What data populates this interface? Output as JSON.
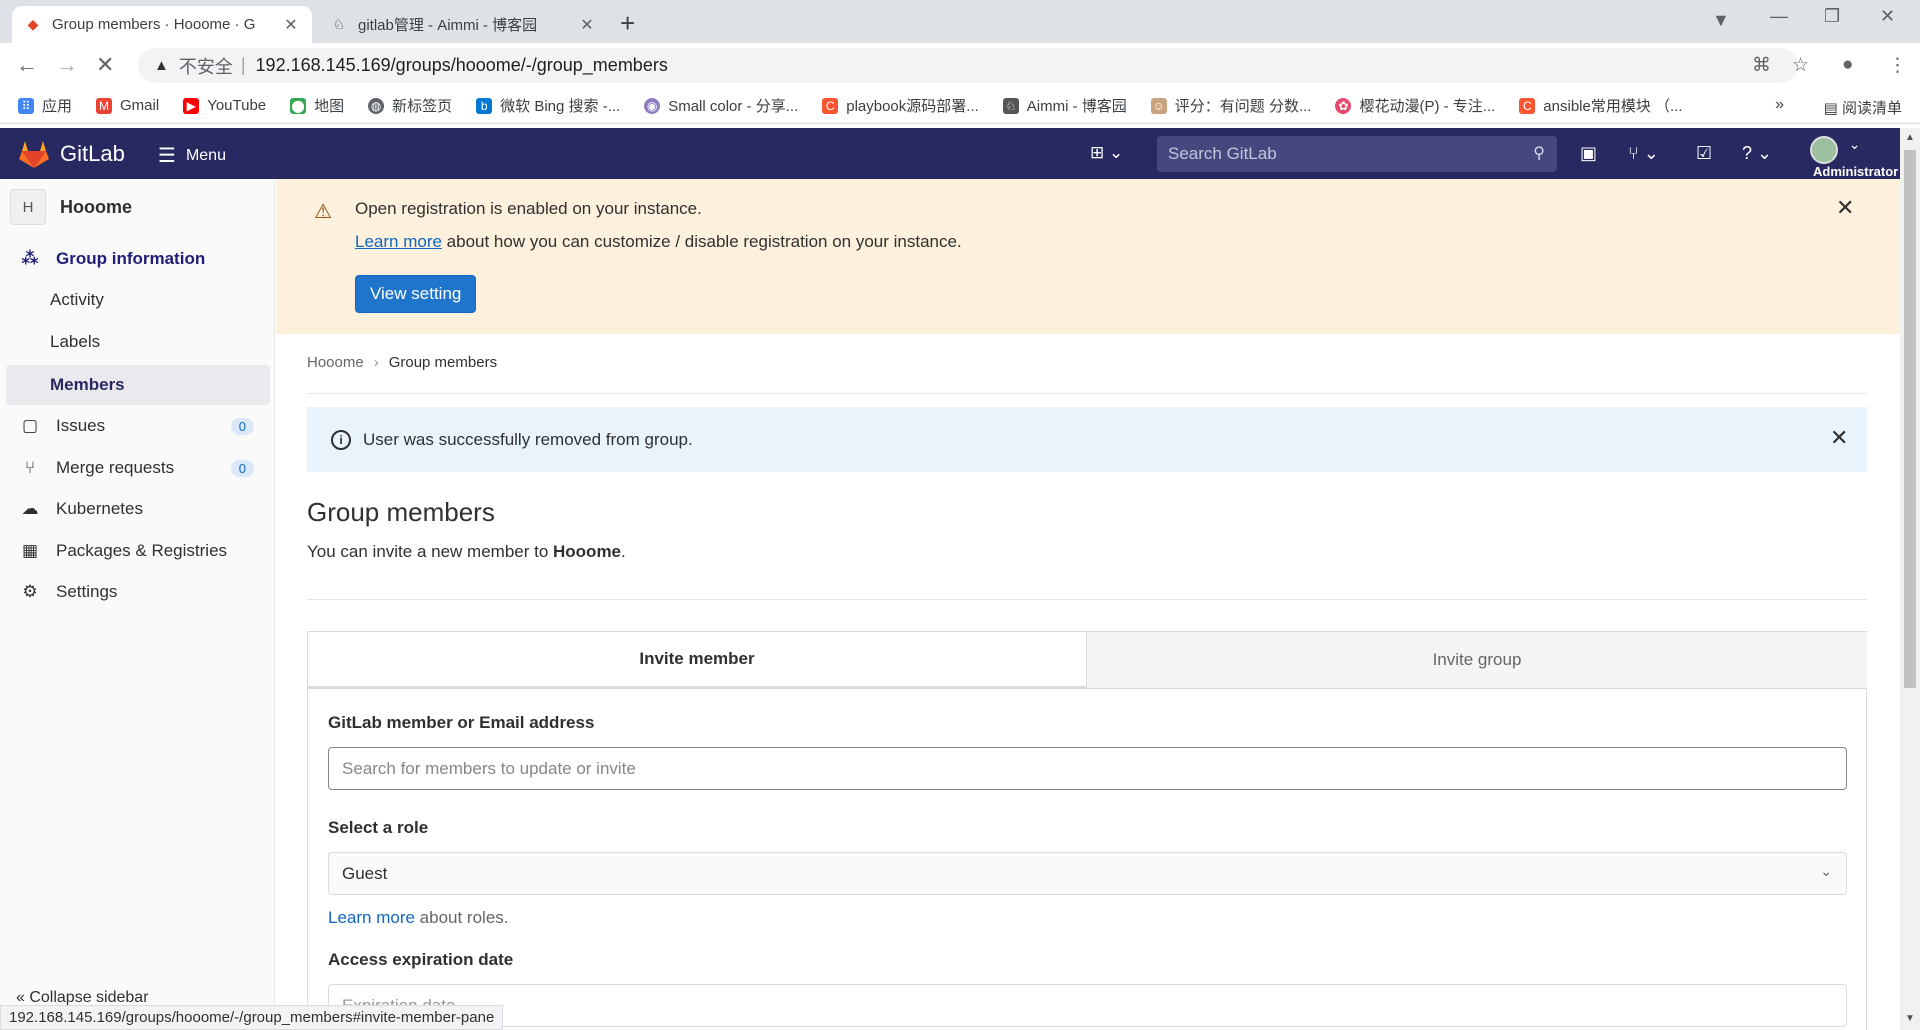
{
  "browser": {
    "tabs": [
      {
        "title": "Group members · Hooome · G",
        "active": true
      },
      {
        "title": "gitlab管理 - Aimmi - 博客园",
        "active": false
      }
    ],
    "address": {
      "insecure_label": "不安全",
      "url": "192.168.145.169/groups/hooome/-/group_members"
    },
    "bookmarks": [
      {
        "label": "应用",
        "icon": "apps-grid-icon",
        "color": "#4285f4"
      },
      {
        "label": "Gmail",
        "icon": "gmail-icon",
        "color": "#ea4335"
      },
      {
        "label": "YouTube",
        "icon": "youtube-icon",
        "color": "#ff0000"
      },
      {
        "label": "地图",
        "icon": "maps-icon",
        "color": "#34a853"
      },
      {
        "label": "新标签页",
        "icon": "globe-icon",
        "color": "#5f6368"
      },
      {
        "label": "微软 Bing 搜索 -...",
        "icon": "bing-icon",
        "color": "#0078d4"
      },
      {
        "label": "Small color - 分享...",
        "icon": "site-icon",
        "color": "#8e7cc3"
      },
      {
        "label": "playbook源码部署...",
        "icon": "csdn-icon",
        "color": "#fc5531"
      },
      {
        "label": "Aimmi - 博客园",
        "icon": "cnblogs-icon",
        "color": "#555555"
      },
      {
        "label": "评分：有问题 分数...",
        "icon": "avatar-icon",
        "color": "#c9a27e"
      },
      {
        "label": "樱花动漫(P) - 专注...",
        "icon": "flower-icon",
        "color": "#e84a6f"
      },
      {
        "label": "ansible常用模块 （...",
        "icon": "csdn-icon",
        "color": "#fc5531"
      }
    ],
    "bookmarks_more": "»",
    "reading_list": "阅读清单",
    "status_url": "192.168.145.169/groups/hooome/-/group_members#invite-member-pane"
  },
  "header": {
    "brand": "GitLab",
    "menu_label": "Menu",
    "search_placeholder": "Search GitLab",
    "user_label": "Administrator",
    "brand_color": "#292961"
  },
  "sidebar": {
    "group_initial": "H",
    "group_name": "Hooome",
    "items": [
      {
        "label": "Group information",
        "icon": "group-info-icon",
        "type": "section"
      },
      {
        "label": "Activity",
        "type": "sub"
      },
      {
        "label": "Labels",
        "type": "sub"
      },
      {
        "label": "Members",
        "type": "sub",
        "active": true
      },
      {
        "label": "Issues",
        "icon": "issues-icon",
        "badge": "0"
      },
      {
        "label": "Merge requests",
        "icon": "merge-request-icon",
        "badge": "0"
      },
      {
        "label": "Kubernetes",
        "icon": "kubernetes-icon"
      },
      {
        "label": "Packages & Registries",
        "icon": "package-icon"
      },
      {
        "label": "Settings",
        "icon": "gear-icon"
      }
    ],
    "collapse_label": "Collapse sidebar"
  },
  "registration_alert": {
    "title": "Open registration is enabled on your instance.",
    "link": "Learn more",
    "text": " about how you can customize / disable registration on your instance.",
    "button": "View setting"
  },
  "breadcrumb": {
    "parent": "Hooome",
    "current": "Group members"
  },
  "info_alert": {
    "text": "User was successfully removed from group."
  },
  "page": {
    "title": "Group members",
    "subtitle_prefix": "You can invite a new member to ",
    "subtitle_group": "Hooome",
    "subtitle_suffix": "."
  },
  "tabs": {
    "invite_member": "Invite member",
    "invite_group": "Invite group"
  },
  "form": {
    "member_label": "GitLab member or Email address",
    "member_placeholder": "Search for members to update or invite",
    "role_label": "Select a role",
    "role_value": "Guest",
    "role_help_link": "Learn more",
    "role_help_text": " about roles.",
    "expiration_label": "Access expiration date",
    "expiration_placeholder": "Expiration date"
  }
}
